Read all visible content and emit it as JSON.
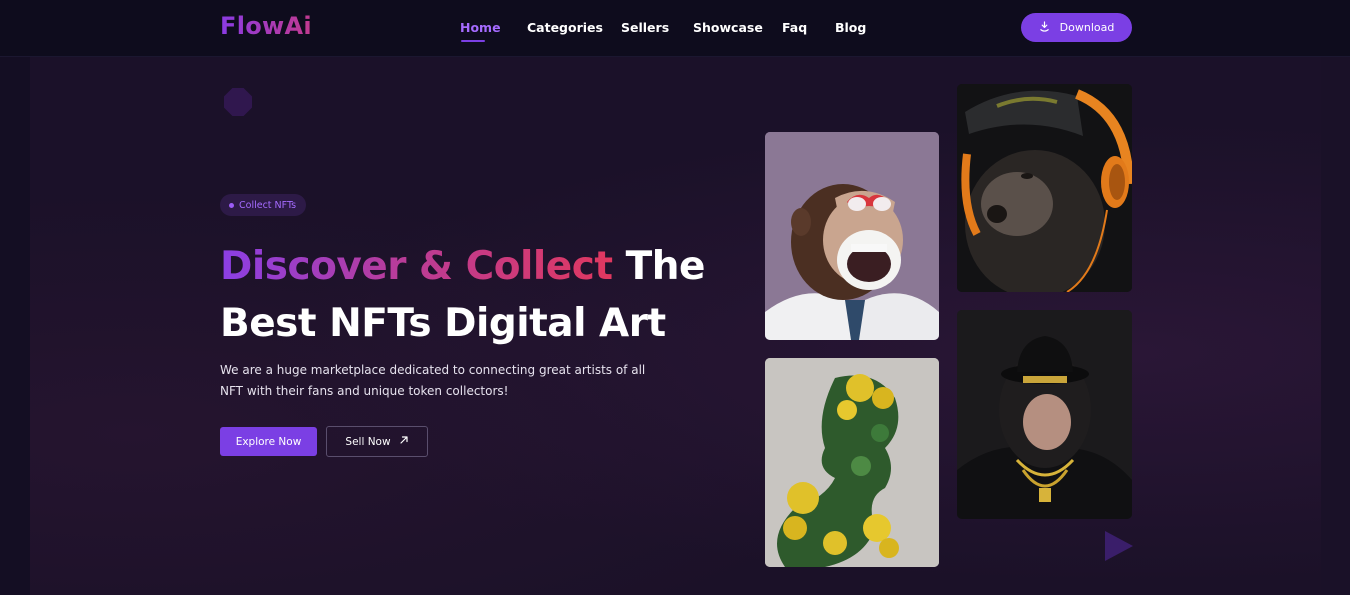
{
  "nav": {
    "logo": "FlowAi",
    "links": [
      "Home",
      "Categories",
      "Sellers",
      "Showcase",
      "Faq",
      "Blog"
    ],
    "active": "Home",
    "download_label": "Download"
  },
  "hero": {
    "pill_label": "Collect NFTs",
    "headline_gradient": "Discover & Collect",
    "headline_plain_1": " The",
    "headline_line_2": "Best NFTs Digital Art",
    "description": "We are a huge marketplace dedicated to connecting great artists of all NFT with their fans and unique token collectors!",
    "explore_label": "Explore Now",
    "sell_label": "Sell Now"
  },
  "gallery": [
    {
      "name": "ape-doctor-heart-glasses"
    },
    {
      "name": "ape-orange-headphones"
    },
    {
      "name": "flower-silhouette-portrait"
    },
    {
      "name": "ape-bowler-hat-gold-chain"
    }
  ],
  "colors": {
    "accent": "#7b3fe4",
    "background": "#1b1129",
    "navbar": "#0e0c1d"
  }
}
